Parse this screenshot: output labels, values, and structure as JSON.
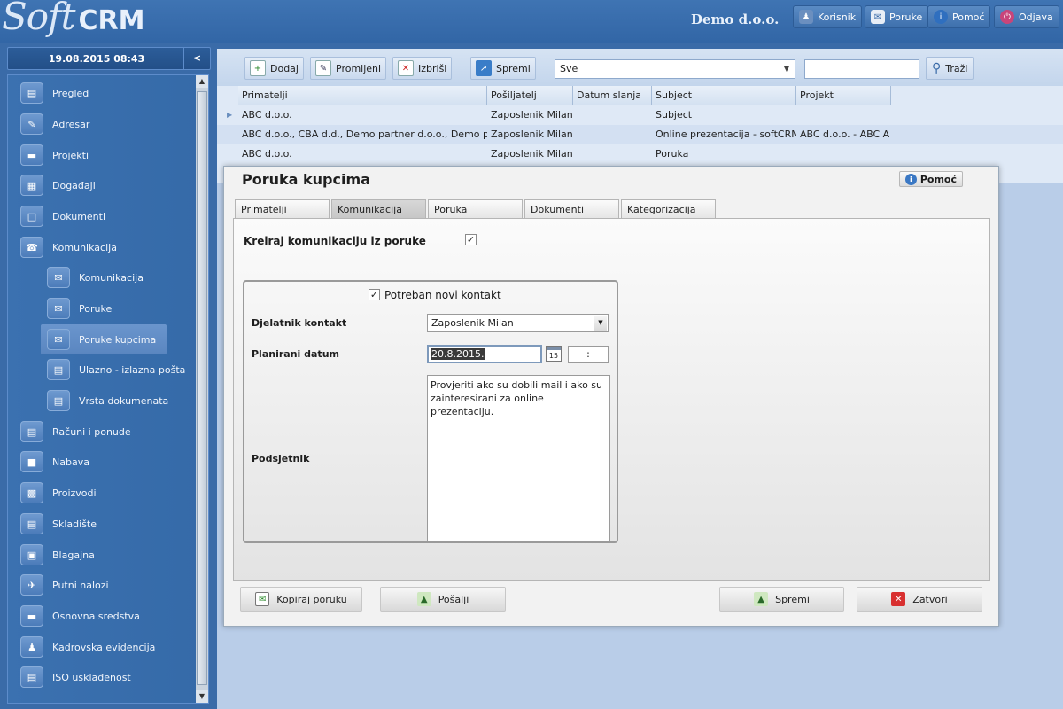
{
  "app": {
    "logo_soft": "Soft",
    "logo_crm": "CRM",
    "company": "Demo d.o.o."
  },
  "header_buttons": [
    {
      "label": "Korisnik",
      "icon": "user-icon"
    },
    {
      "label": "Poruke",
      "icon": "mail-icon"
    },
    {
      "label": "Pomoć",
      "icon": "info-icon"
    },
    {
      "label": "Odjava",
      "icon": "power-icon"
    }
  ],
  "sidebar": {
    "datetime": "19.08.2015 08:43",
    "collapse": "<",
    "items": [
      {
        "label": "Pregled",
        "icon": "overview-icon"
      },
      {
        "label": "Adresar",
        "icon": "address-book-icon"
      },
      {
        "label": "Projekti",
        "icon": "projects-icon"
      },
      {
        "label": "Događaji",
        "icon": "calendar-icon"
      },
      {
        "label": "Dokumenti",
        "icon": "documents-icon"
      },
      {
        "label": "Komunikacija",
        "icon": "communication-icon"
      },
      {
        "label": "Komunikacija",
        "icon": "communication-sub-icon"
      },
      {
        "label": "Poruke",
        "icon": "envelope-icon"
      },
      {
        "label": "Poruke kupcima",
        "icon": "customer-message-icon"
      },
      {
        "label": "Ulazno - izlazna pošta",
        "icon": "mail-inout-icon"
      },
      {
        "label": "Vrsta dokumenata",
        "icon": "doc-type-icon"
      },
      {
        "label": "Računi i ponude",
        "icon": "invoice-icon"
      },
      {
        "label": "Nabava",
        "icon": "procurement-icon"
      },
      {
        "label": "Proizvodi",
        "icon": "products-icon"
      },
      {
        "label": "Skladište",
        "icon": "warehouse-icon"
      },
      {
        "label": "Blagajna",
        "icon": "cash-register-icon"
      },
      {
        "label": "Putni nalozi",
        "icon": "travel-order-icon"
      },
      {
        "label": "Osnovna sredstva",
        "icon": "assets-icon"
      },
      {
        "label": "Kadrovska evidencija",
        "icon": "hr-icon"
      },
      {
        "label": "ISO usklađenost",
        "icon": "iso-icon"
      }
    ]
  },
  "toolbar": {
    "add": "Dodaj",
    "edit": "Promijeni",
    "delete": "Izbriši",
    "save": "Spremi",
    "filter_value": "Sve",
    "search_label": "Traži"
  },
  "grid": {
    "columns": [
      "Primatelji",
      "Pošiljatelj",
      "Datum slanja",
      "Subject",
      "Projekt"
    ],
    "rows": [
      [
        "ABC d.o.o.",
        "Zaposlenik Milan",
        "",
        "Subject",
        ""
      ],
      [
        "ABC d.o.o., CBA d.d., Demo partner d.o.o., Demo par",
        "Zaposlenik Milan",
        "",
        "Online prezentacija - softCRM",
        "ABC d.o.o. - ABC A"
      ],
      [
        "ABC d.o.o.",
        "Zaposlenik Milan",
        "",
        "Poruka",
        ""
      ]
    ]
  },
  "modal": {
    "title": "Poruka kupcima",
    "help": "Pomoć",
    "tabs": [
      "Primatelji",
      "Komunikacija",
      "Poruka",
      "Dokumenti",
      "Kategorizacija"
    ],
    "create_comm_label": "Kreiraj komunikaciju iz poruke",
    "create_comm_checked": true,
    "new_contact_label": "Potreban novi kontakt",
    "new_contact_checked": true,
    "employee_label": "Djelatnik kontakt",
    "employee_value": "Zaposlenik Milan",
    "date_label": "Planirani datum",
    "date_value": "20.8.2015.",
    "calendar_day": "15",
    "time_value": ":",
    "reminder_label": "Podsjetnik",
    "reminder_text": "Provjeriti ako su dobili mail i ako su zainteresirani za online prezentaciju.",
    "buttons": {
      "copy": "Kopiraj poruku",
      "send": "Pošalji",
      "save": "Spremi",
      "close": "Zatvori"
    }
  }
}
